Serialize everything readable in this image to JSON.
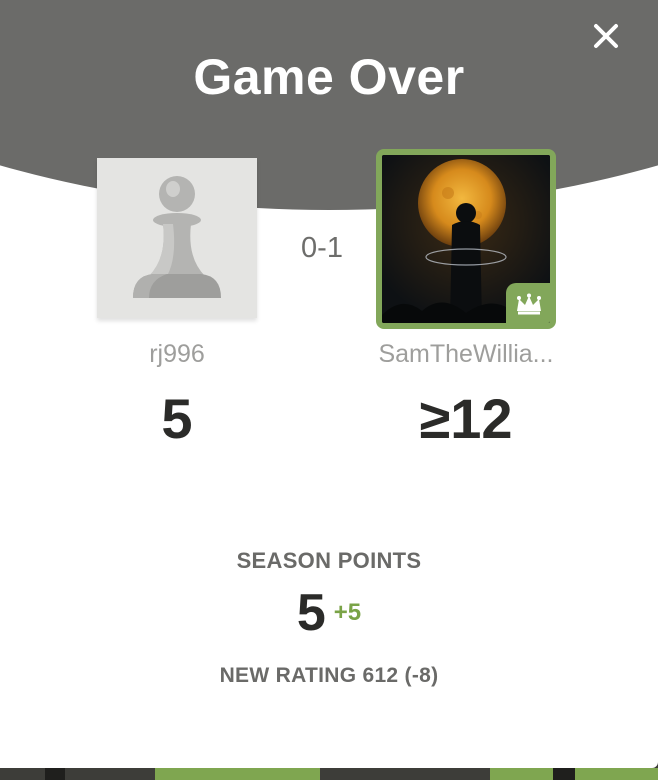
{
  "modal": {
    "title": "Game Over",
    "close_icon": "close-icon"
  },
  "players": {
    "left": {
      "username": "rj996",
      "rating": "5",
      "avatar_icon": "pawn-icon"
    },
    "right": {
      "username": "SamTheWillia...",
      "rating": "≥12",
      "badge_icon": "crown-icon"
    }
  },
  "result": {
    "score": "0-1"
  },
  "season": {
    "label": "SEASON POINTS",
    "points": "5",
    "delta": "+5"
  },
  "new_rating": {
    "text": "NEW RATING 612 (-8)"
  },
  "colors": {
    "header": "#6b6b69",
    "accent_green": "#82a75a",
    "delta_green": "#7aa347",
    "text_dark": "#2b2b29"
  }
}
